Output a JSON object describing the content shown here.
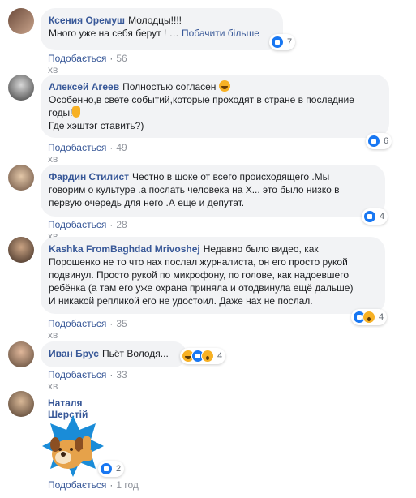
{
  "like_label": "Подобається",
  "comments": [
    {
      "author": "Ксения Оремуш",
      "text": "Молодцы!!!!",
      "text2": "Много уже на себя берут ! …",
      "see_more": "Побачити більше",
      "reactions": "7",
      "time": "56 хв"
    },
    {
      "author": "Алексей Агеев",
      "text": "Полностью согласен",
      "text2": "Особенно,в свете событий,которые проходят в стране в последние",
      "text3": "годы!",
      "text4": "Где хэштэг ставить?)",
      "reactions": "6",
      "time": "49 хв"
    },
    {
      "author": "Фардин Стилист",
      "text": "Честно в шоке от всего происходящего .Мы",
      "text2": "говорим о культуре .а послать человека на Х... это было низко в",
      "text3": "первую очередь для него .А еще и депутат.",
      "reactions": "4",
      "time": "28 хв"
    },
    {
      "author": "Kashka FromBaghdad Mrivoshej",
      "text": "Недавно было видео, как",
      "text2": "Порошенко не то что нах послал журналиста, он его просто рукой",
      "text3": "подвинул. Просто рукой по микрофону, по голове, как надоевшего",
      "text4": "ребёнка (а там его уже охрана приняла и отодвинула ещё дальше)",
      "text5": "И никакой репликой его не удостоил. Даже нах не послал.",
      "reactions": "4",
      "time": "35 хв"
    },
    {
      "author": "Иван Брус",
      "text": "Пьёт Володя...",
      "reactions": "4",
      "time": "33 хв"
    },
    {
      "author": "Наталя Шерстій",
      "reactions": "2",
      "time": "1 год"
    }
  ],
  "colors": {
    "author": "#385898",
    "bubble": "#f2f3f5",
    "like": "#1877f2",
    "sticker_bg": "#1a8cd8"
  },
  "icons": [
    "like-reaction-icon",
    "haha-reaction-icon",
    "wow-reaction-icon",
    "laughing-emoji-icon",
    "hand-emoji-icon",
    "dog-thumbs-up-sticker"
  ]
}
